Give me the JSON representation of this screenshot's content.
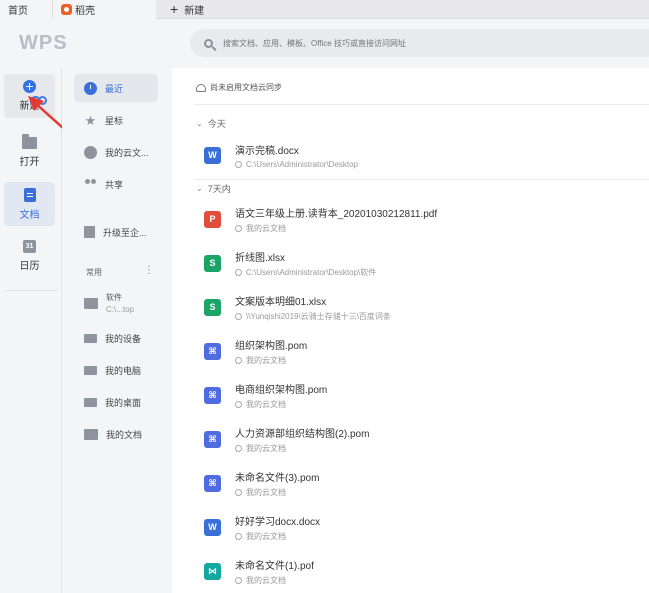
{
  "tabs": [
    {
      "label": "首页"
    },
    {
      "label": "稻壳"
    },
    {
      "label": "新建"
    }
  ],
  "header": {
    "logo": "WPS",
    "search_placeholder": "搜索文档、应用、模板、Office 技巧或直接访问网址"
  },
  "rail": {
    "new_label": "新建",
    "open_label": "打开",
    "doc_label": "文档",
    "cal_label": "日历",
    "cal_glyph": "31"
  },
  "nav": {
    "recent": "最近",
    "star": "星标",
    "cloud": "我的云文...",
    "share": "共享",
    "upgrade": "升级至企...",
    "common_label": "常用",
    "more": "⋮",
    "software_title": "软件",
    "software_path": "C:\\...top",
    "devices": "我的设备",
    "computer": "我的电脑",
    "desktop": "我的桌面",
    "documents": "我的文档"
  },
  "main": {
    "sync_text": "尚未启用文档云同步",
    "group_today": "今天",
    "group_7days": "7天内",
    "files": [
      {
        "name": "演示完稿.docx",
        "path": "C:\\Users\\Administrator\\Desktop",
        "type": "W"
      },
      {
        "name": "语文三年级上册.读背本_20201030212811.pdf",
        "path": "我的云文档",
        "type": "P"
      },
      {
        "name": "折线图.xlsx",
        "path": "C:\\Users\\Administrator\\Desktop\\软件",
        "type": "S"
      },
      {
        "name": "文案版本明细01.xlsx",
        "path": "\\\\Yunqishi2019\\云骑士存储十三\\百度词条",
        "type": "S"
      },
      {
        "name": "组织架构图.pom",
        "path": "我的云文档",
        "type": "POM"
      },
      {
        "name": "电商组织架构图.pom",
        "path": "我的云文档",
        "type": "POM"
      },
      {
        "name": "人力资源部组织结构图(2).pom",
        "path": "我的云文档",
        "type": "POM"
      },
      {
        "name": "未命名文件(3).pom",
        "path": "我的云文档",
        "type": "POM"
      },
      {
        "name": "好好学习docx.docx",
        "path": "我的云文档",
        "type": "W"
      },
      {
        "name": "未命名文件(1).pof",
        "path": "我的云文档",
        "type": "POF"
      }
    ]
  },
  "colors": {
    "accent": "#3a6fd8",
    "annotation_arrow": "#e53935"
  }
}
